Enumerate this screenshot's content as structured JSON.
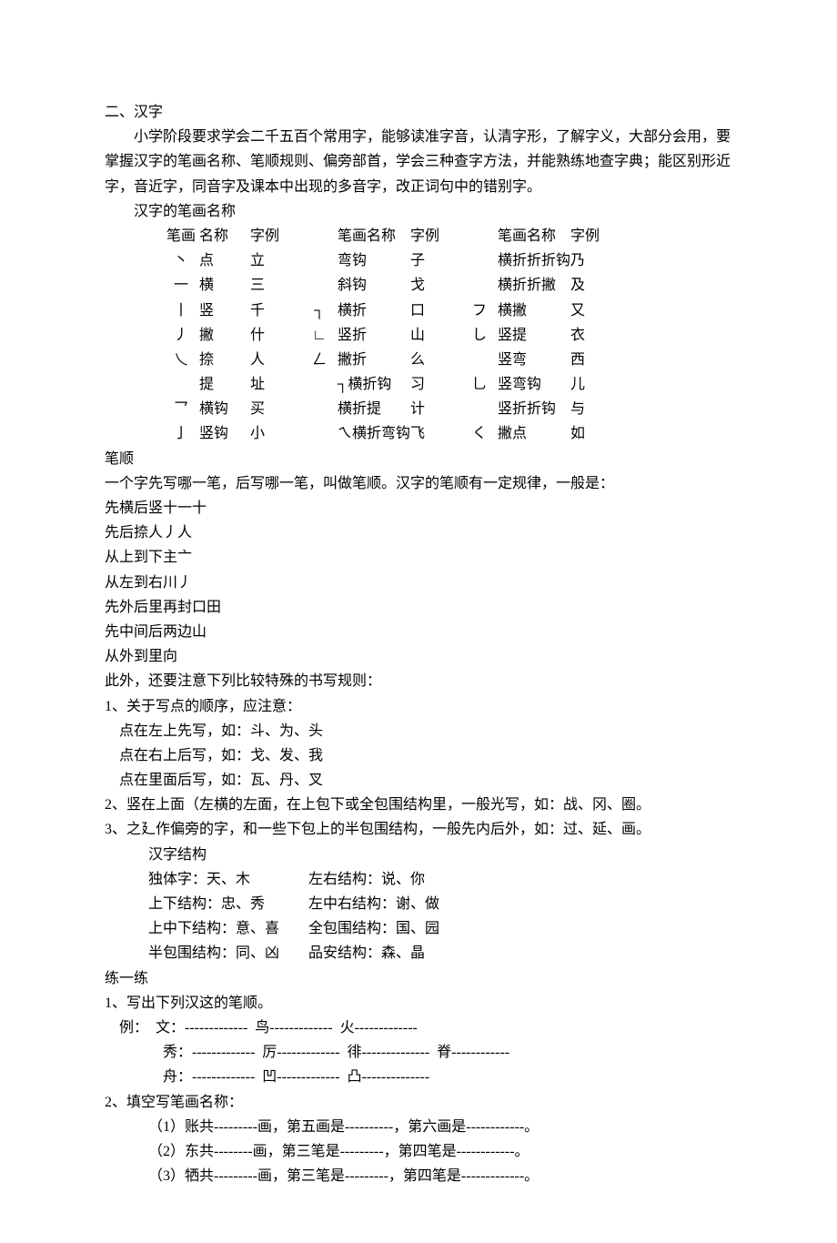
{
  "title": "二、汉字",
  "intro": "小学阶段要求学会二千五百个常用字，能够读准字音，认清字形，了解字义，大部分会用，要掌握汉字的笔画名称、笔顺规则、偏旁部首，学会三种查字方法，并能熟练地查字典；能区别形近字，音近字，同音字及课本中出现的多音字，改正词句中的错别字。",
  "strokes_header": "汉字的笔画名称",
  "stroke_cols_header": {
    "sym": "笔画",
    "name": "名称",
    "ex": "字例",
    "symname": "笔画名称"
  },
  "strokes": {
    "g1": [
      {
        "sym": "丶",
        "name": "点",
        "ex": "立"
      },
      {
        "sym": "一",
        "name": "横",
        "ex": "三"
      },
      {
        "sym": "丨",
        "name": "竖",
        "ex": "千"
      },
      {
        "sym": "丿",
        "name": "撇",
        "ex": "什"
      },
      {
        "sym": "乀",
        "name": "捺",
        "ex": "人"
      },
      {
        "sym": "",
        "name": "提",
        "ex": "址"
      },
      {
        "sym": "乛",
        "name": "横钩",
        "ex": "买"
      },
      {
        "sym": "亅",
        "name": "竖钩",
        "ex": "小"
      }
    ],
    "g2": [
      {
        "sym": "",
        "name": "弯钩",
        "ex": "子"
      },
      {
        "sym": "",
        "name": "斜钩",
        "ex": "戈"
      },
      {
        "sym": "┐",
        "name": "横折",
        "ex": "口"
      },
      {
        "sym": "∟",
        "name": "竖折",
        "ex": "山"
      },
      {
        "sym": "ㄥ",
        "name": "撇折",
        "ex": "么"
      },
      {
        "sym": "",
        "name": "┐横折钩",
        "ex": "习"
      },
      {
        "sym": "",
        "name": "横折提",
        "ex": "计"
      },
      {
        "sym": "",
        "name": "ㄟ横折弯钩",
        "ex": "飞"
      }
    ],
    "g3": [
      {
        "sym": "",
        "name": "横折折折钩",
        "ex": "乃"
      },
      {
        "sym": "",
        "name": "横折折撇",
        "ex": "及"
      },
      {
        "sym": "フ",
        "name": "横撇",
        "ex": "又"
      },
      {
        "sym": "し",
        "name": "竖提",
        "ex": "衣"
      },
      {
        "sym": "",
        "name": "竖弯",
        "ex": "西"
      },
      {
        "sym": "乚",
        "name": "竖弯钩",
        "ex": "儿"
      },
      {
        "sym": "",
        "name": "竖折折钩",
        "ex": "与"
      },
      {
        "sym": "く",
        "name": "撇点",
        "ex": "如"
      }
    ]
  },
  "bishun": {
    "header": "笔顺",
    "intro": "一个字先写哪一笔，后写哪一笔，叫做笔顺。汉字的笔顺有一定规律，一般是：",
    "rules": [
      "先横后竖十一十",
      "先后捺人丿人",
      "从上到下主亠",
      "从左到右川丿",
      "先外后里再封口田",
      "先中间后两边山",
      "从外到里向"
    ],
    "extra_intro": "此外，还要注意下列比较特殊的书写规则：",
    "notes": [
      {
        "head": "1、关于写点的顺序，应注意：",
        "items": [
          "点在左上先写，如：斗、为、头",
          "点在右上后写，如：戈、发、我",
          "点在里面后写，如：瓦、丹、叉"
        ]
      }
    ],
    "note2": "2、竖在上面（左横的左面，在上包下或全包围结构里，一般光写，如：战、冈、圈。",
    "note3": "3、之廴作偏旁的字，和一些下包上的半包围结构，一般先内后外，如：过、延、画。"
  },
  "structure": {
    "header": "汉字结构",
    "rows": [
      {
        "left": "独体字：天、木",
        "right": "左右结构：说、你"
      },
      {
        "left": "上下结构：忠、秀",
        "right": "左中右结构：谢、做"
      },
      {
        "left": "上中下结构：意、喜",
        "right": "全包围结构：国、园"
      },
      {
        "left": "半包围结构：同、凶",
        "right": "品安结构：森、晶"
      }
    ]
  },
  "practice": {
    "header": "练一练",
    "q1": {
      "head": "1、写出下列汉这的笔顺。",
      "example_label": "例：",
      "lines": [
        [
          "文：-------------",
          "鸟-------------",
          "火-------------"
        ],
        [
          "秀：-------------",
          "厉-------------",
          "徘--------------",
          "脊------------"
        ],
        [
          "舟：-------------",
          "凹-------------",
          "凸--------------"
        ]
      ]
    },
    "q2": {
      "head": "2、填空写笔画名称：",
      "items": [
        "（1）账共---------画，第五画是----------，第六画是------------。",
        "（2）东共--------画，第三笔是---------，第四笔是------------。",
        "（3）牺共---------画，第三笔是---------，第四笔是-------------。"
      ]
    }
  }
}
